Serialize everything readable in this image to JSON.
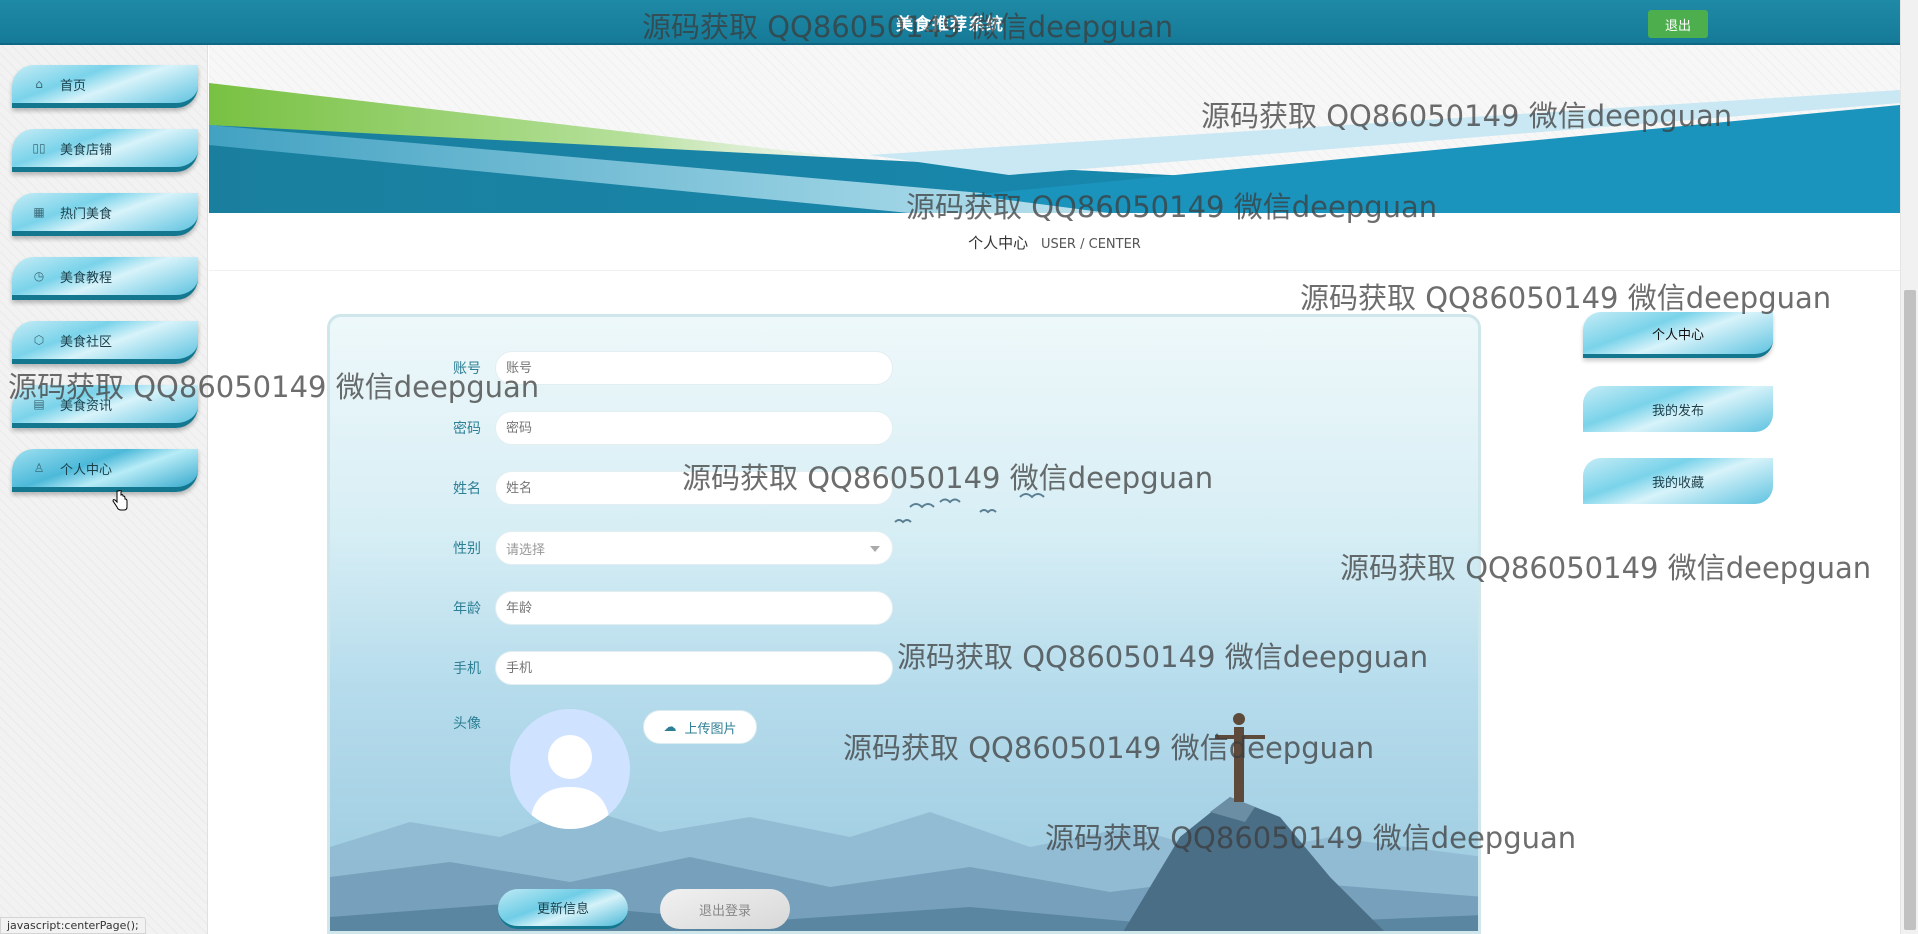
{
  "header": {
    "title": "美食推荐系统",
    "logout_label": "退出"
  },
  "sidebar": {
    "items": [
      {
        "label": "首页",
        "icon": "home-icon"
      },
      {
        "label": "美食店铺",
        "icon": "store-icon"
      },
      {
        "label": "热门美食",
        "icon": "grid-icon"
      },
      {
        "label": "美食教程",
        "icon": "clock-icon"
      },
      {
        "label": "美食社区",
        "icon": "cube-icon"
      },
      {
        "label": "美食资讯",
        "icon": "doc-icon"
      },
      {
        "label": "个人中心",
        "icon": "user-icon"
      }
    ],
    "active": "个人中心"
  },
  "section": {
    "title_cn": "个人中心",
    "title_en": "USER / CENTER"
  },
  "form": {
    "fields": [
      {
        "label": "账号",
        "placeholder": "账号"
      },
      {
        "label": "密码",
        "placeholder": "密码"
      },
      {
        "label": "姓名",
        "placeholder": "姓名"
      },
      {
        "label": "性别",
        "placeholder": "请选择"
      },
      {
        "label": "年龄",
        "placeholder": "年龄"
      },
      {
        "label": "手机",
        "placeholder": "手机"
      }
    ],
    "avatar_label": "头像",
    "upload_label": "上传图片",
    "update_button": "更新信息",
    "logout_button": "退出登录"
  },
  "side_menu": {
    "items": [
      "个人中心",
      "我的发布",
      "我的收藏"
    ]
  },
  "status_bar": {
    "text": "javascript:centerPage();"
  },
  "watermarks": [
    "源码获取 QQ86050149 微信deepguan",
    "源码获取 QQ86050149 微信deepguan",
    "源码获取 QQ86050149 微信deepguan",
    "源码获取 QQ86050149 微信deepguan",
    "源码获取 QQ86050149 微信deepguan",
    "源码获取 QQ86050149 微信deepguan",
    "源码获取 QQ86050149 微信deepguan",
    "源码获取 QQ86050149 微信deepguan",
    "源码获取 QQ86050149 微信deepguan",
    "源码获取 QQ86050149 微信deepguan"
  ],
  "colors": {
    "header": "#1a84a1",
    "accent": "#5fc3e0",
    "logout_green": "#4cae4c"
  }
}
